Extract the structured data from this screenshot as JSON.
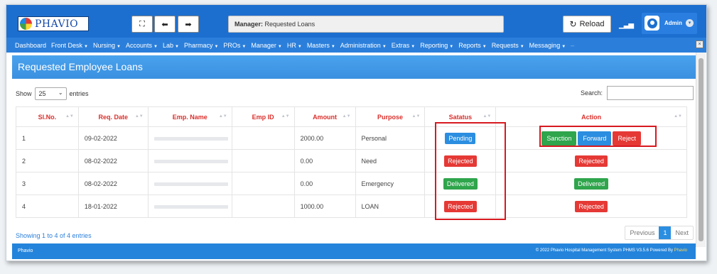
{
  "app": {
    "logo_text": "PHAVIO"
  },
  "toolbar": {
    "expand_icon": "⛶",
    "back_icon": "◆",
    "forward_icon": "➡",
    "title_prefix": "Manager:",
    "title": "Requested Loans",
    "reload_label": "Reload",
    "user": "Admin"
  },
  "menu": [
    "Dashboard",
    "Front Desk",
    "Nursing",
    "Accounts",
    "Lab",
    "Pharmacy",
    "PROs",
    "Manager",
    "HR",
    "Masters",
    "Administration",
    "Extras",
    "Reporting",
    "Reports",
    "Requests",
    "Messaging"
  ],
  "menu_first": "Dashboard",
  "menu_with_caret": [
    false,
    true,
    true,
    true,
    true,
    true,
    true,
    true,
    true,
    true,
    true,
    true,
    true,
    true,
    true,
    true
  ],
  "page": {
    "heading": "Requested Employee Loans",
    "show_label": "Show",
    "entries_value": "25",
    "entries_label": "entries",
    "search_label": "Search:"
  },
  "table": {
    "headers": [
      "Sl.No.",
      "Req. Date",
      "Emp. Name",
      "Emp ID",
      "Amount",
      "Purpose",
      "Satatus",
      "Action"
    ],
    "rows": [
      {
        "sl": "1",
        "date": "09-02-2022",
        "amount": "2000.00",
        "purpose": "Personal",
        "status": "Pending",
        "status_color": "#2b8ee0"
      },
      {
        "sl": "2",
        "date": "08-02-2022",
        "amount": "0.00",
        "purpose": "Need",
        "status": "Rejected",
        "status_color": "#e53935",
        "action": "Rejected"
      },
      {
        "sl": "3",
        "date": "08-02-2022",
        "amount": "0.00",
        "purpose": "Emergency",
        "status": "Delivered",
        "status_color": "#2fa54c",
        "action": "Delivered"
      },
      {
        "sl": "4",
        "date": "18-01-2022",
        "amount": "1000.00",
        "purpose": "LOAN",
        "status": "Rejected",
        "status_color": "#e53935",
        "action": "Rejected"
      }
    ],
    "row1_actions": {
      "sanction": "Sanction",
      "forward": "Forward",
      "reject": "Reject"
    }
  },
  "pagination": {
    "summary": "Showing 1 to 4 of 4 entries",
    "previous": "Previous",
    "page": "1",
    "next": "Next"
  },
  "footer": {
    "left": "Phavio",
    "right_prefix": "© 2022 Phavio Hospital Management System PHMS V3.5.6 Powered By",
    "right_brand": "Phavio"
  },
  "colors": {
    "primary": "#1c6fcf",
    "menu": "#2b7fdb",
    "header_text": "#d9302c",
    "highlight": "#d71920"
  }
}
